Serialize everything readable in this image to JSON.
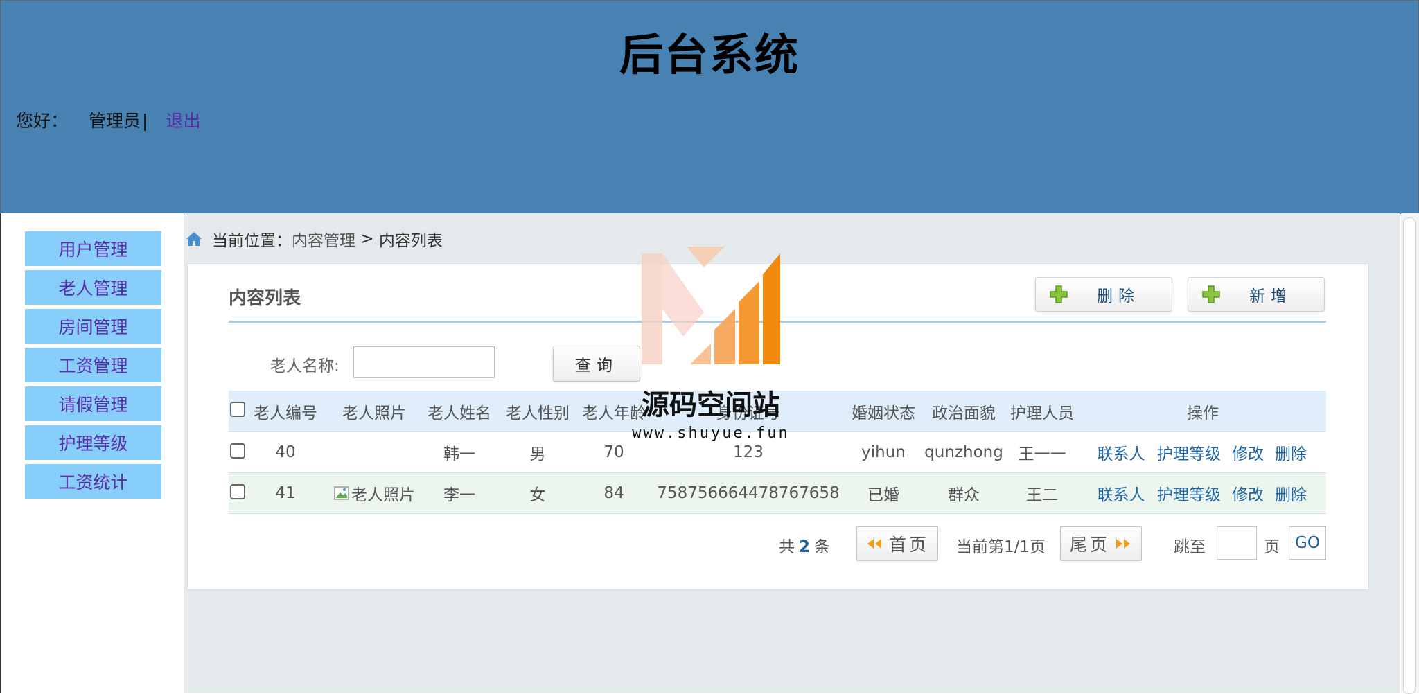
{
  "header": {
    "title": "后台系统",
    "greeting": "您好：",
    "username": "管理员",
    "separator": "|",
    "logout": "退出"
  },
  "sidebar": {
    "items": [
      {
        "label": "用户管理"
      },
      {
        "label": "老人管理"
      },
      {
        "label": "房间管理"
      },
      {
        "label": "工资管理"
      },
      {
        "label": "请假管理"
      },
      {
        "label": "护理等级"
      },
      {
        "label": "工资统计"
      }
    ]
  },
  "breadcrumb": {
    "prefix": "当前位置：",
    "parent": "内容管理",
    "separator": " > ",
    "current": "内容列表",
    "icon": "home-icon"
  },
  "panel": {
    "title": "内容列表",
    "delete_label": "删除",
    "add_label": "新增"
  },
  "search": {
    "label": "老人名称:",
    "value": "",
    "button": "查询"
  },
  "table": {
    "columns": [
      "老人编号",
      "老人照片",
      "老人姓名",
      "老人性别",
      "老人年龄",
      "身份证号",
      "婚姻状态",
      "政治面貌",
      "护理人员",
      "操作"
    ],
    "rows": [
      {
        "id": "40",
        "photo": "",
        "name": "韩一",
        "gender": "男",
        "age": "70",
        "idcard": "123",
        "marital": "yihun",
        "political": "qunzhong",
        "caregiver": "王一一"
      },
      {
        "id": "41",
        "photo": "老人照片",
        "name": "李一",
        "gender": "女",
        "age": "84",
        "idcard": "758756664478767658",
        "marital": "已婚",
        "political": "群众",
        "caregiver": "王二"
      }
    ],
    "actions": [
      "联系人",
      "护理等级",
      "修改",
      "删除"
    ]
  },
  "pagination": {
    "total_prefix": "共",
    "total": "2",
    "total_suffix": "条",
    "first": "首页",
    "current": "当前第1/1页",
    "last": "尾页",
    "jump_label": "跳至",
    "jump_value": "",
    "page_unit": "页",
    "go": "GO"
  },
  "watermark": {
    "text": "源码空间站",
    "url": "www.shuyue.fun"
  },
  "colors": {
    "header_bg": "#4882b2",
    "menu_bg": "#87cefa",
    "menu_text": "#5b2ca8",
    "link": "#1f64a8"
  }
}
